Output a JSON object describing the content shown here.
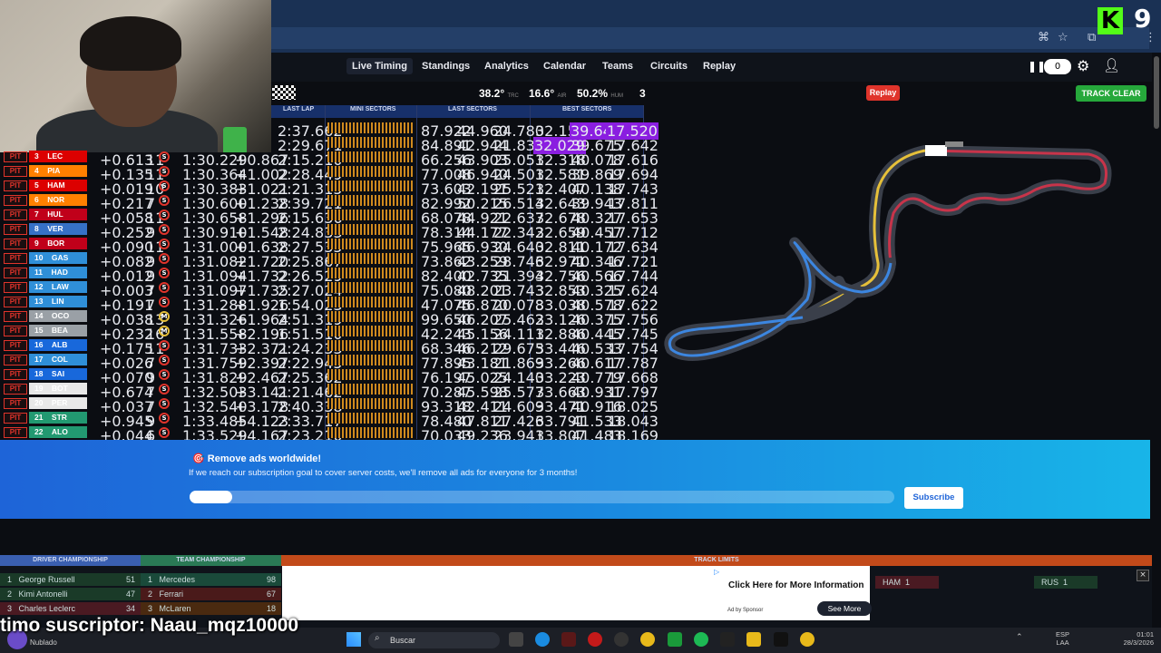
{
  "nav": {
    "items": [
      "Live Timing",
      "Standings",
      "Analytics",
      "Calendar",
      "Teams",
      "Circuits",
      "Replay"
    ],
    "counter": "0"
  },
  "status": {
    "track_temp": "38.2°",
    "track_label": "TRC",
    "air_temp": "16.6°",
    "air_label": "AIR",
    "humidity": "50.2%",
    "hum_label": "HUM",
    "wind": "3",
    "replay_label": "Replay",
    "track_clear_label": "TRACK CLEAR"
  },
  "table_headers": {
    "last_lap": "LAST LAP",
    "mini_sectors": "MINI SECTORS",
    "last_sectors": "LAST SECTORS",
    "best_sectors": "BEST SECTORS"
  },
  "colors": {
    "pit_red": "#e0342b",
    "purple": "#8a1ee0",
    "green": "#26a83b"
  },
  "top_rows": [
    {
      "last": "2:37.662",
      "s1": "87.922",
      "s2": "44.960",
      "s3": "24.780",
      "b1": "32.159",
      "b2": "39.646",
      "b3": "17.520",
      "p1": false,
      "p2": true,
      "p3": true
    },
    {
      "last": "2:29.671",
      "s1": "84.891",
      "s2": "42.944",
      "s3": "21.836",
      "b1": "32.029",
      "b2": "39.675",
      "b3": "17.642",
      "p1": true,
      "p2": false,
      "p3": false
    }
  ],
  "rows": [
    {
      "pit": "PIT",
      "pos": "3",
      "driver": "LEC",
      "team_color": "#dc0000",
      "gap": "+0.613",
      "laps": "11",
      "tyre": "S",
      "best": "1:30.229",
      "int": "+0.867",
      "last": "2:15.210",
      "s1": "66.256",
      "s2": "43.903",
      "s3": "25.051",
      "b1": "32.318",
      "b2": "40.078",
      "b3": "17.616"
    },
    {
      "pit": "PIT",
      "pos": "4",
      "driver": "PIA",
      "team_color": "#ff8000",
      "gap": "+0.135",
      "laps": "11",
      "tyre": "S",
      "best": "1:30.364",
      "int": "+1.002",
      "last": "2:28.449",
      "s1": "77.008",
      "s2": "46.940",
      "s3": "24.501",
      "b1": "32.581",
      "b2": "39.869",
      "b3": "17.694"
    },
    {
      "pit": "PIT",
      "pos": "5",
      "driver": "HAM",
      "team_color": "#dc0000",
      "gap": "+0.019",
      "laps": "10",
      "tyre": "S",
      "best": "1:30.383",
      "int": "+1.021",
      "last": "2:21.315",
      "s1": "73.603",
      "s2": "42.191",
      "s3": "25.521",
      "b1": "32.407",
      "b2": "40.138",
      "b3": "17.743"
    },
    {
      "pit": "PIT",
      "pos": "6",
      "driver": "NOR",
      "team_color": "#ff8000",
      "gap": "+0.217",
      "laps": "7",
      "tyre": "S",
      "best": "1:30.600",
      "int": "+1.238",
      "last": "2:39.721",
      "s1": "82.992",
      "s2": "50.215",
      "s3": "26.514",
      "b1": "32.643",
      "b2": "39.943",
      "b3": "17.811"
    },
    {
      "pit": "PIT",
      "pos": "7",
      "driver": "HUL",
      "team_color": "#c0001a",
      "gap": "+0.058",
      "laps": "11",
      "tyre": "S",
      "best": "1:30.658",
      "int": "+1.296",
      "last": "2:15.636",
      "s1": "68.078",
      "s2": "44.921",
      "s3": "22.637",
      "b1": "32.678",
      "b2": "40.327",
      "b3": "17.653"
    },
    {
      "pit": "PIT",
      "pos": "8",
      "driver": "VER",
      "team_color": "#3671c6",
      "gap": "+0.252",
      "laps": "9",
      "tyre": "S",
      "best": "1:30.910",
      "int": "+1.548",
      "last": "2:24.833",
      "s1": "78.314",
      "s2": "44.177",
      "s3": "22.342",
      "b1": "32.659",
      "b2": "40.457",
      "b3": "17.712"
    },
    {
      "pit": "PIT",
      "pos": "9",
      "driver": "BOR",
      "team_color": "#c0001a",
      "gap": "+0.090",
      "laps": "11",
      "tyre": "S",
      "best": "1:31.000",
      "int": "+1.638",
      "last": "2:27.535",
      "s1": "75.965",
      "s2": "46.930",
      "s3": "24.640",
      "b1": "32.811",
      "b2": "40.172",
      "b3": "17.634"
    },
    {
      "pit": "PIT",
      "pos": "10",
      "driver": "GAS",
      "team_color": "#2f8fd8",
      "gap": "+0.082",
      "laps": "9",
      "tyre": "S",
      "best": "1:31.082",
      "int": "+1.720",
      "last": "2:25.867",
      "s1": "73.862",
      "s2": "43.259",
      "s3": "28.746",
      "b1": "32.971",
      "b2": "40.346",
      "b3": "17.721"
    },
    {
      "pit": "PIT",
      "pos": "11",
      "driver": "HAD",
      "team_color": "#2f8fd8",
      "gap": "+0.012",
      "laps": "9",
      "tyre": "S",
      "best": "1:31.094",
      "int": "+1.732",
      "last": "2:26.529",
      "s1": "82.400",
      "s2": "42.735",
      "s3": "21.394",
      "b1": "32.756",
      "b2": "40.566",
      "b3": "17.744"
    },
    {
      "pit": "PIT",
      "pos": "12",
      "driver": "LAW",
      "team_color": "#2f8fd8",
      "gap": "+0.003",
      "laps": "7",
      "tyre": "S",
      "best": "1:31.097",
      "int": "+1.735",
      "last": "2:27.024",
      "s1": "75.080",
      "s2": "48.201",
      "s3": "23.743",
      "b1": "32.853",
      "b2": "40.325",
      "b3": "17.624"
    },
    {
      "pit": "PIT",
      "pos": "13",
      "driver": "LIN",
      "team_color": "#2f8fd8",
      "gap": "+0.191",
      "laps": "7",
      "tyre": "S",
      "best": "1:31.288",
      "int": "+1.926",
      "last": "1:54.023",
      "s1": "47.075",
      "s2": "46.870",
      "s3": "20.078",
      "b1": "33.038",
      "b2": "40.578",
      "b3": "17.622"
    },
    {
      "pit": "PIT",
      "pos": "14",
      "driver": "OCO",
      "team_color": "#9aa0a6",
      "gap": "+0.038",
      "laps": "13",
      "tyre": "M",
      "best": "1:31.326",
      "int": "+1.964",
      "last": "2:51.319",
      "s1": "99.650",
      "s2": "46.207",
      "s3": "25.462",
      "b1": "33.126",
      "b2": "40.375",
      "b3": "17.756"
    },
    {
      "pit": "PIT",
      "pos": "15",
      "driver": "BEA",
      "team_color": "#9aa0a6",
      "gap": "+0.232",
      "laps": "16",
      "tyre": "M",
      "best": "1:31.558",
      "int": "+2.196",
      "last": "1:51.510",
      "s1": "42.243",
      "s2": "45.156",
      "s3": "24.111",
      "b1": "32.886",
      "b2": "40.445",
      "b3": "17.745"
    },
    {
      "pit": "PIT",
      "pos": "16",
      "driver": "ALB",
      "team_color": "#1868db",
      "gap": "+0.175",
      "laps": "11",
      "tyre": "S",
      "best": "1:31.733",
      "int": "+2.371",
      "last": "2:24.233",
      "s1": "68.346",
      "s2": "46.212",
      "s3": "29.675",
      "b1": "33.446",
      "b2": "40.533",
      "b3": "17.754"
    },
    {
      "pit": "PIT",
      "pos": "17",
      "driver": "COL",
      "team_color": "#2f8fd8",
      "gap": "+0.026",
      "laps": "7",
      "tyre": "S",
      "best": "1:31.759",
      "int": "+2.397",
      "last": "2:22.945",
      "s1": "77.895",
      "s2": "43.181",
      "s3": "21.869",
      "b1": "33.266",
      "b2": "40.617",
      "b3": "17.787"
    },
    {
      "pit": "PIT",
      "pos": "18",
      "driver": "SAI",
      "team_color": "#1868db",
      "gap": "+0.070",
      "laps": "9",
      "tyre": "S",
      "best": "1:31.829",
      "int": "+2.467",
      "last": "2:25.362",
      "s1": "76.197",
      "s2": "45.025",
      "s3": "24.140",
      "b1": "33.223",
      "b2": "40.779",
      "b3": "17.668"
    },
    {
      "pit": "PIT",
      "pos": "19",
      "driver": "BOT",
      "team_color": "#e8e8e8",
      "gap": "+0.674",
      "laps": "7",
      "tyre": "S",
      "best": "1:32.503",
      "int": "+3.141",
      "last": "2:21.462",
      "s1": "70.287",
      "s2": "45.598",
      "s3": "25.577",
      "b1": "33.663",
      "b2": "40.931",
      "b3": "17.797"
    },
    {
      "pit": "PIT",
      "pos": "20",
      "driver": "PER",
      "team_color": "#e8e8e8",
      "gap": "+0.037",
      "laps": "7",
      "tyre": "S",
      "best": "1:32.540",
      "int": "+3.178",
      "last": "2:40.338",
      "s1": "93.318",
      "s2": "42.411",
      "s3": "24.609",
      "b1": "33.471",
      "b2": "40.916",
      "b3": "18.025"
    },
    {
      "pit": "PIT",
      "pos": "21",
      "driver": "STR",
      "team_color": "#229971",
      "gap": "+0.945",
      "laps": "9",
      "tyre": "S",
      "best": "1:33.485",
      "int": "+4.123",
      "last": "2:33.717",
      "s1": "78.480",
      "s2": "47.811",
      "s3": "27.426",
      "b1": "33.791",
      "b2": "41.533",
      "b3": "18.043"
    },
    {
      "pit": "PIT",
      "pos": "22",
      "driver": "ALO",
      "team_color": "#229971",
      "gap": "+0.044",
      "laps": "6",
      "tyre": "S",
      "best": "1:33.529",
      "int": "+4.167",
      "last": "2:23.210",
      "s1": "70.033",
      "s2": "49.236",
      "s3": "23.941",
      "b1": "33.807",
      "b2": "41.483",
      "b3": "18.169"
    }
  ],
  "banner": {
    "title": "Remove ads worldwide!",
    "text": "If we reach our subscription goal to cover server costs, we'll remove all ads for everyone for 3 months!",
    "progress": 0.06,
    "button": "Subscribe"
  },
  "bottom": {
    "driver_champ_label": "DRIVER CHAMPIONSHIP",
    "team_champ_label": "TEAM CHAMPIONSHIP",
    "track_limits_label": "TRACK LIMITS",
    "drivers": [
      {
        "pos": "1",
        "name": "George Russell",
        "pts": "51"
      },
      {
        "pos": "2",
        "name": "Kimi Antonelli",
        "pts": "47"
      },
      {
        "pos": "3",
        "name": "Charles Leclerc",
        "pts": "34"
      }
    ],
    "teams": [
      {
        "pos": "1",
        "name": "Mercedes",
        "pts": "98"
      },
      {
        "pos": "2",
        "name": "Ferrari",
        "pts": "67"
      },
      {
        "pos": "3",
        "name": "McLaren",
        "pts": "18"
      }
    ],
    "track_limit_entries": [
      {
        "driver": "HAM",
        "count": "1"
      },
      {
        "driver": "RUS",
        "count": "1"
      }
    ]
  },
  "ad": {
    "title": "Click Here for More Information",
    "sponsor": "Ad by Sponsor",
    "button": "See More"
  },
  "overlay": "timo suscriptor: Naau_mqz10000",
  "taskbar": {
    "search_placeholder": "Buscar",
    "weather_label": "Nublado",
    "lang": "ESP",
    "lang2": "LAA",
    "time": "01:01",
    "date": "28/3/2026"
  },
  "kick": {
    "count": "9"
  }
}
